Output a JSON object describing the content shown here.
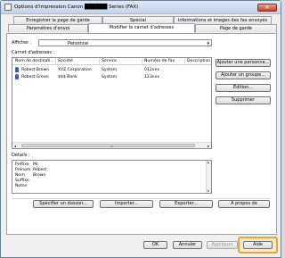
{
  "window": {
    "title": "Options d'impression Canon ██████ Series (FAX)",
    "close_glyph": "✕"
  },
  "tabs": {
    "row_top": [
      "Enregistrer la page de garde",
      "Spécial",
      "Informations et images des fax envoyés"
    ],
    "row_bottom": [
      "Paramètres d'envoi",
      "Modifier le carnet d'adresses",
      "Page de garde"
    ],
    "active": "Modifier le carnet d'adresses"
  },
  "display": {
    "label": "Afficher :",
    "value": "Personne",
    "arrow": "▾"
  },
  "address_book": {
    "label": "Carnet d'adresses :",
    "columns": [
      "Nom de destinati...",
      "Société",
      "Service",
      "Numéro de fax",
      "Description"
    ],
    "rows": [
      [
        "Robert Brown",
        "XYZ Corporation",
        "System",
        "012xxx",
        ""
      ],
      [
        "Robert Green",
        "$$$ Bank",
        "System",
        "123xxx",
        ""
      ]
    ],
    "scroll_left": "◂",
    "scroll_right": "▸",
    "scroll_grip": "≡"
  },
  "side_buttons": {
    "add_person": "Ajouter une personne...",
    "add_group": "Ajouter un groupe...",
    "edit": "Edition...",
    "delete": "Supprimer"
  },
  "details": {
    "label": "Détails :",
    "fields": [
      {
        "key": "Préfixe",
        "value": "Mr."
      },
      {
        "key": "Prénom",
        "value": "Robert"
      },
      {
        "key": "Nom",
        "value": "Brown"
      },
      {
        "key": "Suffixe",
        "value": ""
      },
      {
        "key": "Notes",
        "value": ""
      }
    ],
    "scroll_up": "▴",
    "scroll_down": "▾"
  },
  "bottom_buttons": {
    "specify_folder": "Spécifier un dossier...",
    "import": "Importer...",
    "export": "Exporter...",
    "about": "A propos de"
  },
  "dialog_buttons": {
    "ok": "OK",
    "cancel": "Annuler",
    "apply": "Appliquer",
    "help": "Aide"
  },
  "colors": {
    "highlight": "#f0a62a",
    "title_bar": "#c3d4e8"
  }
}
